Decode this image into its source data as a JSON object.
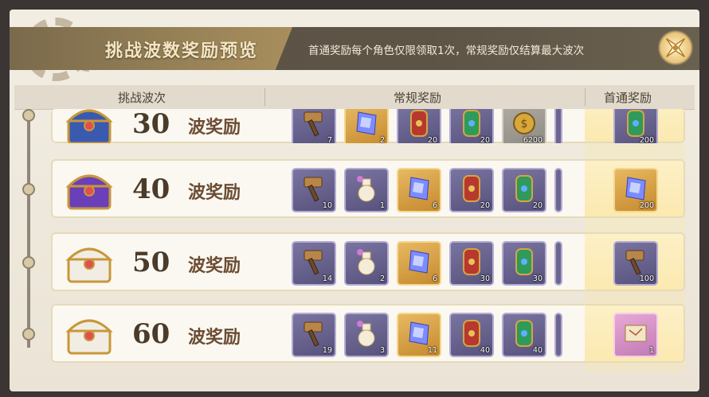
{
  "title": "挑战波数奖励预览",
  "subtitle": "首通奖励每个角色仅限领取1次，常规奖励仅结算最大波次",
  "headers": {
    "wave": "挑战波次",
    "regular": "常规奖励",
    "first": "首通奖励"
  },
  "colors": {
    "accent": "#a88e5e",
    "first_bg": "#fbe9b0",
    "text_dark": "#4a3b2a"
  },
  "rows": [
    {
      "wave": "30",
      "label": "波奖励",
      "chest": "blue-gold-chest",
      "regular": [
        {
          "icon": "hammer-icon",
          "count": "7",
          "rarity": "purple"
        },
        {
          "icon": "crystal-icon",
          "count": "2",
          "rarity": "gold"
        },
        {
          "icon": "red-scroll-icon",
          "count": "20",
          "rarity": "purple"
        },
        {
          "icon": "green-scroll-icon",
          "count": "20",
          "rarity": "purple"
        },
        {
          "icon": "gold-coin-icon",
          "count": "6200",
          "rarity": "gray"
        }
      ],
      "first": {
        "icon": "green-scroll-icon",
        "count": "200",
        "rarity": "purple"
      }
    },
    {
      "wave": "40",
      "label": "波奖励",
      "chest": "purple-chest",
      "regular": [
        {
          "icon": "hammer-icon",
          "count": "10",
          "rarity": "purple"
        },
        {
          "icon": "vase-icon",
          "count": "1",
          "rarity": "purple"
        },
        {
          "icon": "crystal-icon",
          "count": "6",
          "rarity": "gold"
        },
        {
          "icon": "red-scroll-icon",
          "count": "20",
          "rarity": "purple"
        },
        {
          "icon": "green-scroll-icon",
          "count": "20",
          "rarity": "purple"
        }
      ],
      "first": {
        "icon": "crystal-icon",
        "count": "200",
        "rarity": "gold"
      }
    },
    {
      "wave": "50",
      "label": "波奖励",
      "chest": "red-gold-chest",
      "regular": [
        {
          "icon": "hammer-icon",
          "count": "14",
          "rarity": "purple"
        },
        {
          "icon": "vase-icon",
          "count": "2",
          "rarity": "purple"
        },
        {
          "icon": "crystal-icon",
          "count": "6",
          "rarity": "gold"
        },
        {
          "icon": "red-scroll-icon",
          "count": "30",
          "rarity": "purple"
        },
        {
          "icon": "green-scroll-icon",
          "count": "30",
          "rarity": "purple"
        }
      ],
      "first": {
        "icon": "hammer-icon",
        "count": "100",
        "rarity": "purple"
      }
    },
    {
      "wave": "60",
      "label": "波奖励",
      "chest": "red-gold-chest",
      "regular": [
        {
          "icon": "hammer-icon",
          "count": "19",
          "rarity": "purple"
        },
        {
          "icon": "vase-icon",
          "count": "3",
          "rarity": "purple"
        },
        {
          "icon": "crystal-icon",
          "count": "11",
          "rarity": "gold"
        },
        {
          "icon": "red-scroll-icon",
          "count": "40",
          "rarity": "purple"
        },
        {
          "icon": "green-scroll-icon",
          "count": "40",
          "rarity": "purple"
        }
      ],
      "first": {
        "icon": "map-scroll-icon",
        "count": "1",
        "rarity": "pink"
      }
    }
  ]
}
